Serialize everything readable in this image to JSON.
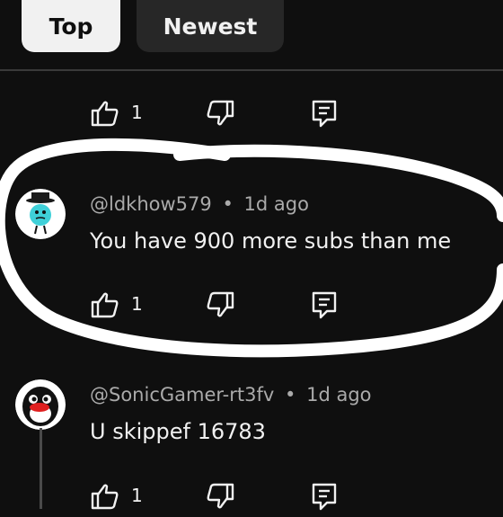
{
  "filters": {
    "top": "Top",
    "newest": "Newest"
  },
  "first_actions": {
    "likes": "1"
  },
  "comments": [
    {
      "author": "@ldkhow579",
      "separator": "•",
      "time": "1d ago",
      "text": "You have 900 more subs than me",
      "likes": "1",
      "avatar_color": "#3fd0d8"
    },
    {
      "author": "@SonicGamer-rt3fv",
      "separator": "•",
      "time": "1d ago",
      "text": "U skippef 16783",
      "likes": "1",
      "avatar_color": "#111111"
    }
  ],
  "icons": {
    "like": "thumbs-up-icon",
    "dislike": "thumbs-down-icon",
    "reply": "reply-icon"
  },
  "annotation": {
    "color": "#ffffff",
    "shape": "hand-drawn-oval"
  }
}
